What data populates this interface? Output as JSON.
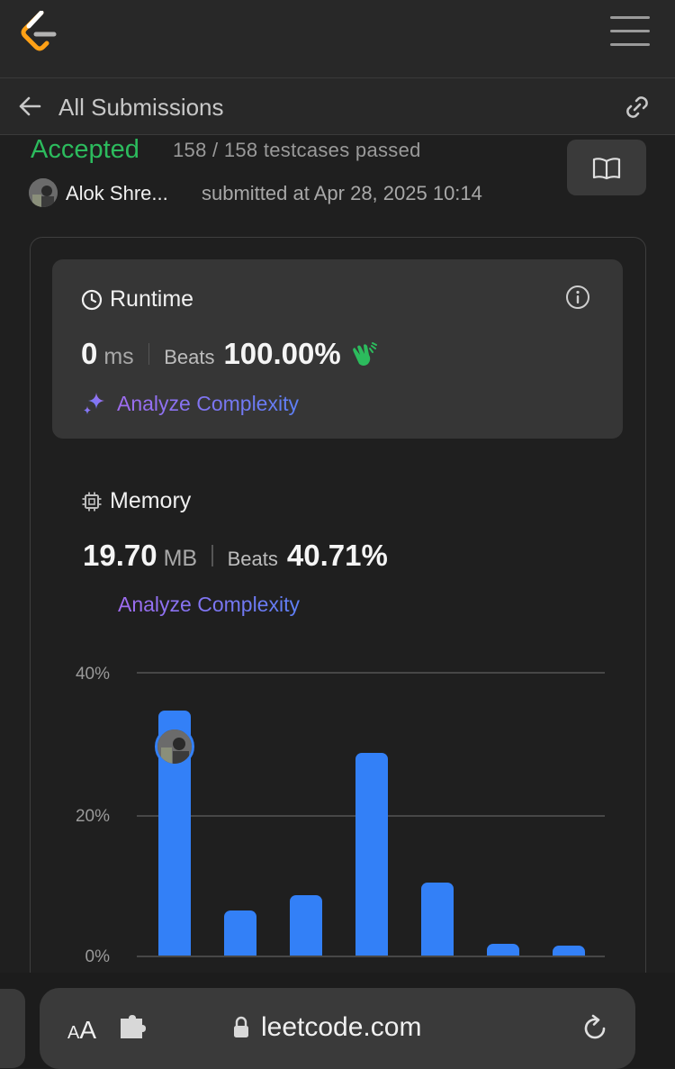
{
  "header": {
    "logo_icon": "leetcode-logo",
    "menu_icon": "hamburger-icon"
  },
  "subheader": {
    "back_icon": "arrow-left-icon",
    "title": "All Submissions",
    "share_icon": "link-icon"
  },
  "result": {
    "status": "Accepted",
    "status_color": "#2cbb5d",
    "testcases": "158 / 158 testcases passed",
    "author": "Alok Shre...",
    "submitted": "submitted at Apr 28, 2025 10:14",
    "editorial_icon": "book-icon"
  },
  "runtime": {
    "label": "Runtime",
    "value": "0",
    "unit": "ms",
    "beats_label": "Beats",
    "beats": "100.00%",
    "analyze": "Analyze Complexity"
  },
  "memory": {
    "label": "Memory",
    "value": "19.70",
    "unit": "MB",
    "beats_label": "Beats",
    "beats": "40.71%",
    "analyze": "Analyze Complexity"
  },
  "chart_data": {
    "type": "bar",
    "ylim": [
      0,
      40
    ],
    "yticks": [
      "40%",
      "20%",
      "0%"
    ],
    "values": [
      34.5,
      6.4,
      8.5,
      28.6,
      10.3,
      1.6,
      1.4
    ],
    "highlight_index": 0,
    "bar_color": "#3380f7",
    "grid": true
  },
  "browser": {
    "aa_small": "A",
    "aa_large": "A",
    "url": "leetcode.com"
  }
}
